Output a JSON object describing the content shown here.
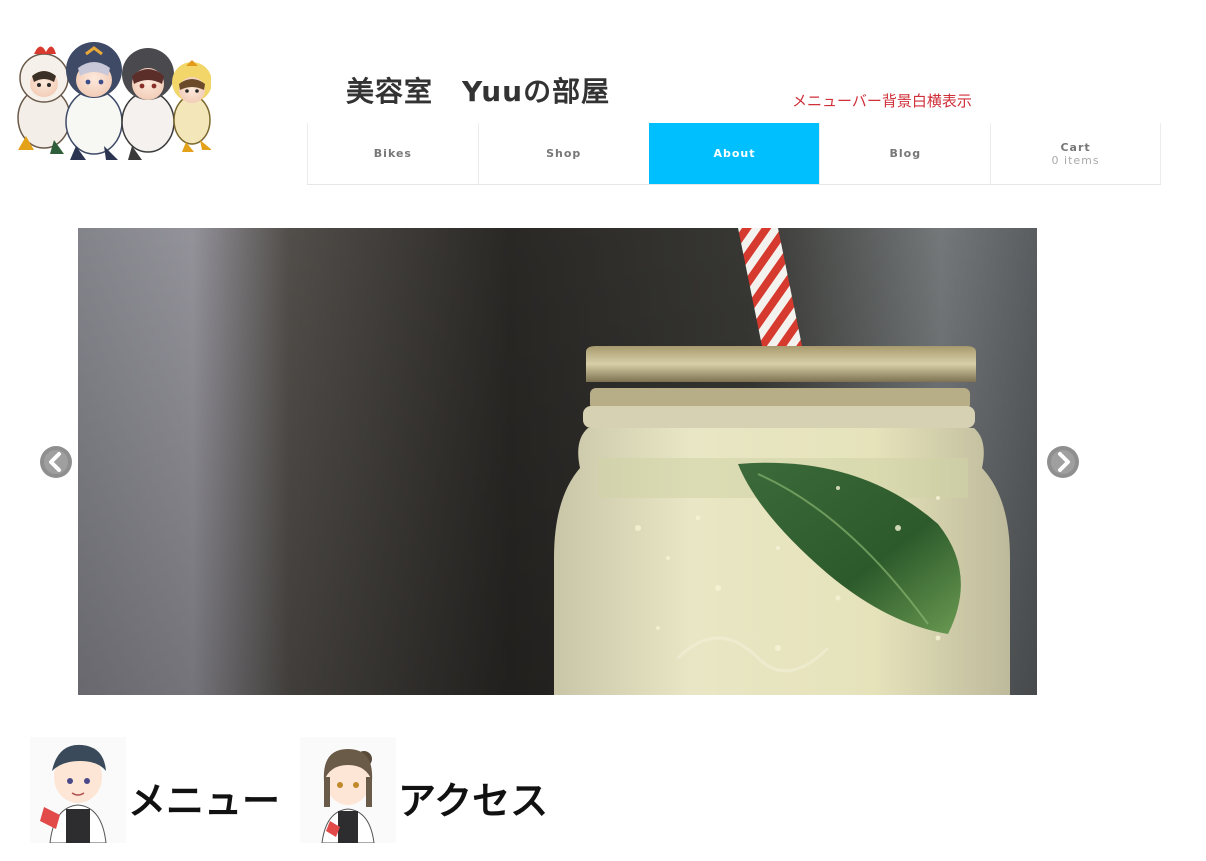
{
  "header": {
    "site_title": "美容室　Yuuの部屋",
    "note": "メニューバー背景白横表示"
  },
  "nav": {
    "items": [
      {
        "label": "Bikes"
      },
      {
        "label": "Shop"
      },
      {
        "label": "About",
        "active": true
      },
      {
        "label": "Blog"
      },
      {
        "label": "Cart",
        "sub": "0 items"
      }
    ]
  },
  "slider": {
    "prev_icon": "chevron-left-circle-icon",
    "next_icon": "chevron-right-circle-icon"
  },
  "sections": {
    "menu_label": "メニュー",
    "access_label": "アクセス"
  },
  "colors": {
    "active_nav": "#00bfff",
    "note_text": "#d0303a",
    "title_text": "#333333"
  }
}
